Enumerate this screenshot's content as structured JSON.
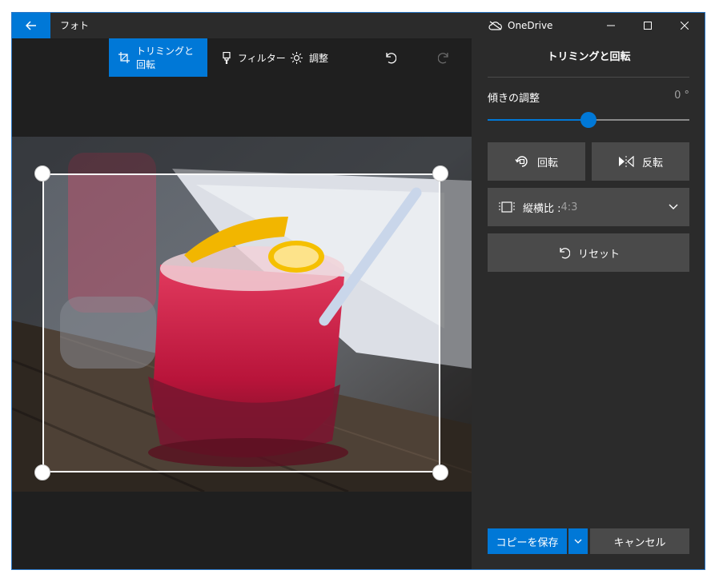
{
  "titlebar": {
    "app_title": "フォト",
    "onedrive_label": "OneDrive",
    "icons": [
      "back-arrow-icon",
      "cloud-icon",
      "minimize-icon",
      "maximize-icon",
      "close-icon"
    ]
  },
  "toolbar": {
    "crop_rotate_label": "トリミングと回転",
    "filter_label": "フィルター",
    "adjust_label": "調整"
  },
  "panel": {
    "title": "トリミングと回転",
    "straighten_label": "傾きの調整",
    "straighten_value": "0 °",
    "straighten_fraction": 0.5,
    "rotate_label": "回転",
    "flip_label": "反転",
    "aspect_label": "縦横比 : ",
    "aspect_value": "4:3",
    "reset_label": "リセット",
    "save_copy_label": "コピーを保存",
    "cancel_label": "キャンセル"
  },
  "colors": {
    "accent": "#0078d7",
    "window_bg": "#1f1f1f",
    "panel_bg": "#2b2b2b",
    "button_bg": "#4a4a4a"
  }
}
